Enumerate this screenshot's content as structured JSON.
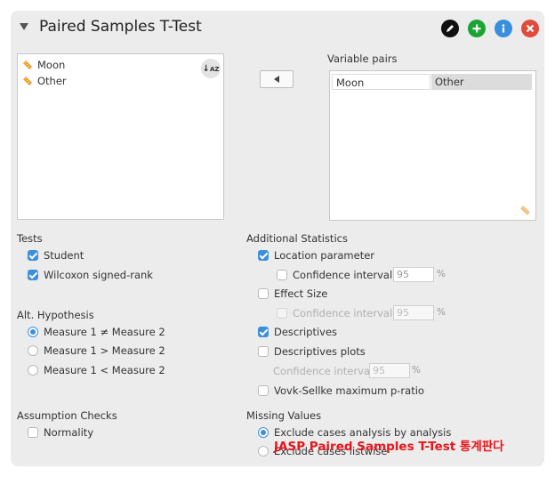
{
  "header": {
    "title": "Paired Samples T-Test"
  },
  "variables": {
    "available": [
      "Moon",
      "Other"
    ],
    "pairs_label": "Variable pairs",
    "pair": [
      "Moon",
      "Other"
    ]
  },
  "tests": {
    "label": "Tests",
    "student": "Student",
    "wilcoxon": "Wilcoxon signed-rank"
  },
  "alt_hypothesis": {
    "label": "Alt. Hypothesis",
    "neq": "Measure 1 ≠ Measure 2",
    "gt": "Measure 1 > Measure 2",
    "lt": "Measure 1 < Measure 2"
  },
  "assumption": {
    "label": "Assumption Checks",
    "normality": "Normality"
  },
  "additional": {
    "label": "Additional Statistics",
    "location": "Location parameter",
    "ci1": "Confidence interval",
    "ci1_value": "95",
    "effect_size": "Effect Size",
    "ci2": "Confidence interval",
    "ci2_value": "95",
    "descriptives": "Descriptives",
    "descriptives_plots": "Descriptives plots",
    "ci3": "Confidence interval",
    "ci3_value": "95",
    "vovk": "Vovk-Sellke maximum p-ratio",
    "percent": "%"
  },
  "missing": {
    "label": "Missing Values",
    "exclude_analysis": "Exclude cases analysis by analysis",
    "exclude_listwise": "Exclude cases listwise"
  },
  "watermark": "JASP Paired Samples T-Test 통계판다",
  "colors": {
    "edit": "#111111",
    "add": "#1aa533",
    "info": "#3a8fdc",
    "close": "#e14b3b",
    "accent": "#3c8fdd"
  }
}
